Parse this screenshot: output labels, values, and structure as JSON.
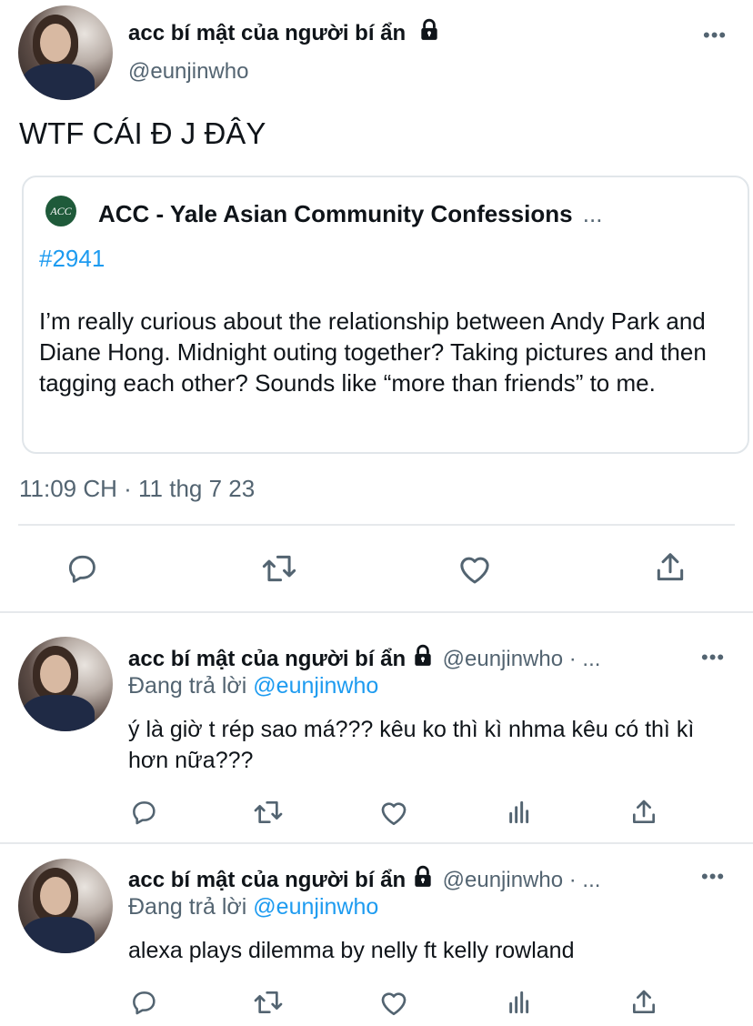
{
  "main_tweet": {
    "author_name": "acc bí mật của người bí ẩn",
    "handle": "@eunjinwho",
    "text": "WTF CÁI Đ J ĐÂY",
    "quote": {
      "account_name": "ACC - Yale Asian Community Confessions",
      "ellipsis": "...",
      "logo_text": "ACC",
      "hashtag": "#2941",
      "body": "I’m really curious about the relationship between Andy Park and Diane Hong. Midnight outing together? Taking pictures and then tagging each other? Sounds like “more than friends” to me."
    },
    "timestamp": "11:09 CH · 11 thg 7 23"
  },
  "replies": [
    {
      "author_name": "acc bí mật của người bí ẩn",
      "handle_meta": "@eunjinwho · ...",
      "replying_prefix": "Đang trả lời",
      "replying_to": "@eunjinwho",
      "text": "ý là giờ t rép sao má??? kêu ko thì kì nhma kêu có thì kì hơn nữa???"
    },
    {
      "author_name": "acc bí mật của người bí ẩn",
      "handle_meta": "@eunjinwho · ...",
      "replying_prefix": "Đang trả lời",
      "replying_to": "@eunjinwho",
      "text": "alexa plays dilemma by nelly ft kelly rowland"
    }
  ],
  "ui": {
    "more": "•••"
  },
  "colors": {
    "link": "#1d9bf0",
    "text": "#0f1419",
    "secondary": "#536471",
    "divider": "#e6e9ec"
  },
  "icons": [
    "lock-icon",
    "more-icon",
    "reply-icon",
    "retweet-icon",
    "like-icon",
    "views-icon",
    "share-icon"
  ]
}
